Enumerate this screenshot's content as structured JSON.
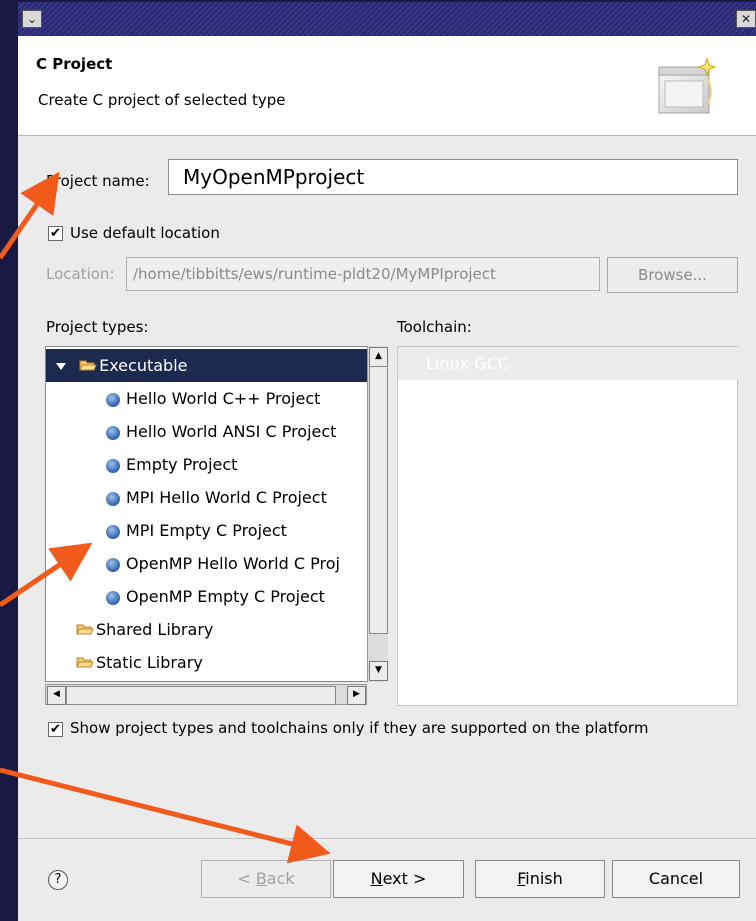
{
  "window": {
    "menu_icon": "chevron-down-icon",
    "close_icon": "close-icon"
  },
  "banner": {
    "title": "C Project",
    "description": "Create C project of selected type",
    "image_icon": "new-project-wizard-icon"
  },
  "project_name": {
    "label": "Project name:",
    "value": "MyOpenMPproject"
  },
  "use_default_location": {
    "label": "Use default location",
    "checked": true
  },
  "location": {
    "label": "Location:",
    "value": "/home/tibbitts/ews/runtime-pldt20/MyMPIproject",
    "browse": "Browse..."
  },
  "project_types": {
    "label": "Project types:",
    "items": [
      {
        "label": "Executable",
        "kind": "folder",
        "expanded": true,
        "selected": true
      },
      {
        "label": "Hello World C++ Project",
        "kind": "template"
      },
      {
        "label": "Hello World ANSI C Project",
        "kind": "template"
      },
      {
        "label": "Empty Project",
        "kind": "template"
      },
      {
        "label": "MPI Hello World C Project",
        "kind": "template"
      },
      {
        "label": "MPI Empty C Project",
        "kind": "template"
      },
      {
        "label": "OpenMP Hello World C Proj",
        "kind": "template"
      },
      {
        "label": "OpenMP Empty C Project",
        "kind": "template"
      },
      {
        "label": "Shared Library",
        "kind": "folder"
      },
      {
        "label": "Static Library",
        "kind": "folder"
      }
    ]
  },
  "toolchain": {
    "label": "Toolchain:",
    "items": [
      "Linux GCC"
    ]
  },
  "show_supported": {
    "label": "Show project types and toolchains only if they are supported on the platform",
    "checked": true
  },
  "buttons": {
    "back_prefix": "< ",
    "back_mnemonic": "B",
    "back_rest": "ack",
    "next_mnemonic": "N",
    "next_rest": "ext >",
    "finish_mnemonic": "F",
    "finish_rest": "inish",
    "cancel": "Cancel"
  },
  "help_icon": "?",
  "colors": {
    "selection": "#1c2a4f",
    "arrow": "#f05a1a",
    "slide_background": "#1a1944"
  }
}
